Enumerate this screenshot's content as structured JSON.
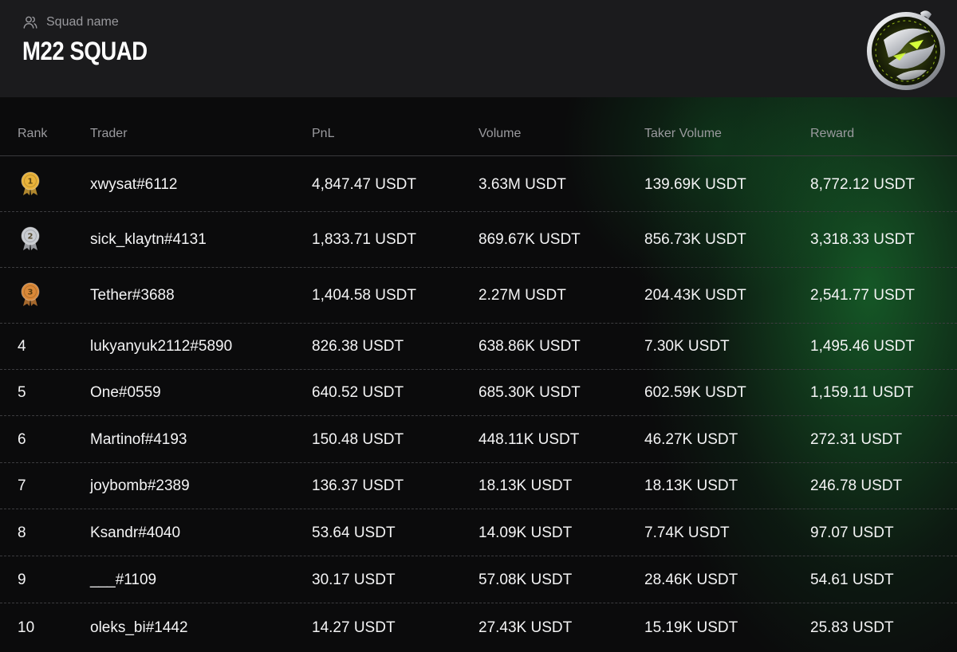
{
  "header": {
    "label": "Squad name",
    "title": "M22 SQUAD"
  },
  "table": {
    "columns": [
      "Rank",
      "Trader",
      "PnL",
      "Volume",
      "Taker Volume",
      "Reward"
    ],
    "rows": [
      {
        "rank": "1",
        "medal": "gold",
        "trader": "xwysat#6112",
        "pnl": "4,847.47 USDT",
        "volume": "3.63M USDT",
        "taker": "139.69K USDT",
        "reward": "8,772.12 USDT"
      },
      {
        "rank": "2",
        "medal": "silver",
        "trader": "sick_klaytn#4131",
        "pnl": "1,833.71 USDT",
        "volume": "869.67K USDT",
        "taker": "856.73K USDT",
        "reward": "3,318.33 USDT"
      },
      {
        "rank": "3",
        "medal": "bronze",
        "trader": "Tether#3688",
        "pnl": "1,404.58 USDT",
        "volume": "2.27M USDT",
        "taker": "204.43K USDT",
        "reward": "2,541.77 USDT"
      },
      {
        "rank": "4",
        "medal": "",
        "trader": "lukyanyuk2112#5890",
        "pnl": "826.38 USDT",
        "volume": "638.86K USDT",
        "taker": "7.30K USDT",
        "reward": "1,495.46 USDT"
      },
      {
        "rank": "5",
        "medal": "",
        "trader": "One#0559",
        "pnl": "640.52 USDT",
        "volume": "685.30K USDT",
        "taker": "602.59K USDT",
        "reward": "1,159.11 USDT"
      },
      {
        "rank": "6",
        "medal": "",
        "trader": "Martinof#4193",
        "pnl": "150.48 USDT",
        "volume": "448.11K USDT",
        "taker": "46.27K USDT",
        "reward": "272.31 USDT"
      },
      {
        "rank": "7",
        "medal": "",
        "trader": "joybomb#2389",
        "pnl": "136.37 USDT",
        "volume": "18.13K USDT",
        "taker": "18.13K USDT",
        "reward": "246.78 USDT"
      },
      {
        "rank": "8",
        "medal": "",
        "trader": "Ksandr#4040",
        "pnl": "53.64 USDT",
        "volume": "14.09K USDT",
        "taker": "7.74K USDT",
        "reward": "97.07 USDT"
      },
      {
        "rank": "9",
        "medal": "",
        "trader": "___#1109",
        "pnl": "30.17 USDT",
        "volume": "57.08K USDT",
        "taker": "28.46K USDT",
        "reward": "54.61 USDT"
      },
      {
        "rank": "10",
        "medal": "",
        "trader": "oleks_bi#1442",
        "pnl": "14.27 USDT",
        "volume": "27.43K USDT",
        "taker": "15.19K USDT",
        "reward": "25.83 USDT"
      }
    ]
  },
  "icons": {
    "header_label_icon": "users-icon",
    "badge_icon": "squad-emblem-icon",
    "medal_icon": "medal-icon"
  },
  "colors": {
    "gold": "#e8b23a",
    "silver": "#c9ccd1",
    "bronze": "#d98838",
    "accent_green": "#b6e51e"
  }
}
